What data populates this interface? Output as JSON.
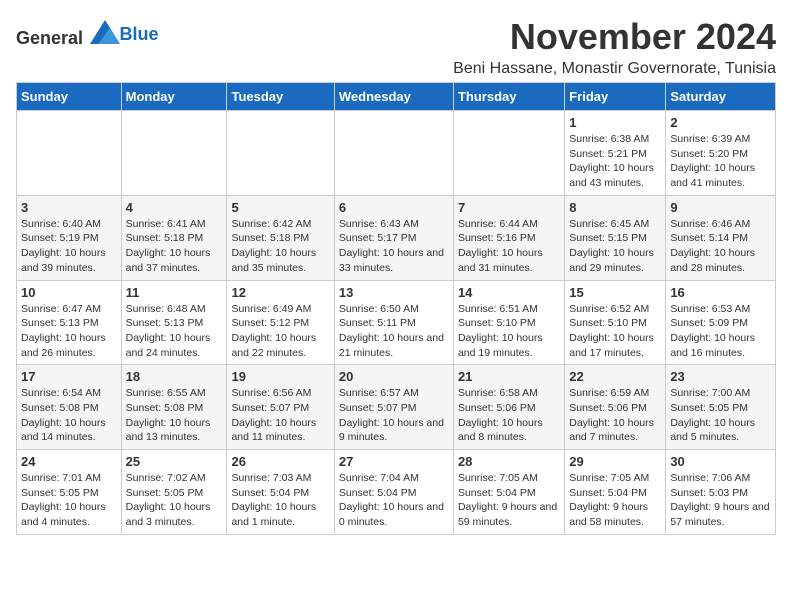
{
  "header": {
    "logo_general": "General",
    "logo_blue": "Blue",
    "month_title": "November 2024",
    "location": "Beni Hassane, Monastir Governorate, Tunisia"
  },
  "weekdays": [
    "Sunday",
    "Monday",
    "Tuesday",
    "Wednesday",
    "Thursday",
    "Friday",
    "Saturday"
  ],
  "weeks": [
    [
      {
        "day": "",
        "info": ""
      },
      {
        "day": "",
        "info": ""
      },
      {
        "day": "",
        "info": ""
      },
      {
        "day": "",
        "info": ""
      },
      {
        "day": "",
        "info": ""
      },
      {
        "day": "1",
        "info": "Sunrise: 6:38 AM\nSunset: 5:21 PM\nDaylight: 10 hours and 43 minutes."
      },
      {
        "day": "2",
        "info": "Sunrise: 6:39 AM\nSunset: 5:20 PM\nDaylight: 10 hours and 41 minutes."
      }
    ],
    [
      {
        "day": "3",
        "info": "Sunrise: 6:40 AM\nSunset: 5:19 PM\nDaylight: 10 hours and 39 minutes."
      },
      {
        "day": "4",
        "info": "Sunrise: 6:41 AM\nSunset: 5:18 PM\nDaylight: 10 hours and 37 minutes."
      },
      {
        "day": "5",
        "info": "Sunrise: 6:42 AM\nSunset: 5:18 PM\nDaylight: 10 hours and 35 minutes."
      },
      {
        "day": "6",
        "info": "Sunrise: 6:43 AM\nSunset: 5:17 PM\nDaylight: 10 hours and 33 minutes."
      },
      {
        "day": "7",
        "info": "Sunrise: 6:44 AM\nSunset: 5:16 PM\nDaylight: 10 hours and 31 minutes."
      },
      {
        "day": "8",
        "info": "Sunrise: 6:45 AM\nSunset: 5:15 PM\nDaylight: 10 hours and 29 minutes."
      },
      {
        "day": "9",
        "info": "Sunrise: 6:46 AM\nSunset: 5:14 PM\nDaylight: 10 hours and 28 minutes."
      }
    ],
    [
      {
        "day": "10",
        "info": "Sunrise: 6:47 AM\nSunset: 5:13 PM\nDaylight: 10 hours and 26 minutes."
      },
      {
        "day": "11",
        "info": "Sunrise: 6:48 AM\nSunset: 5:13 PM\nDaylight: 10 hours and 24 minutes."
      },
      {
        "day": "12",
        "info": "Sunrise: 6:49 AM\nSunset: 5:12 PM\nDaylight: 10 hours and 22 minutes."
      },
      {
        "day": "13",
        "info": "Sunrise: 6:50 AM\nSunset: 5:11 PM\nDaylight: 10 hours and 21 minutes."
      },
      {
        "day": "14",
        "info": "Sunrise: 6:51 AM\nSunset: 5:10 PM\nDaylight: 10 hours and 19 minutes."
      },
      {
        "day": "15",
        "info": "Sunrise: 6:52 AM\nSunset: 5:10 PM\nDaylight: 10 hours and 17 minutes."
      },
      {
        "day": "16",
        "info": "Sunrise: 6:53 AM\nSunset: 5:09 PM\nDaylight: 10 hours and 16 minutes."
      }
    ],
    [
      {
        "day": "17",
        "info": "Sunrise: 6:54 AM\nSunset: 5:08 PM\nDaylight: 10 hours and 14 minutes."
      },
      {
        "day": "18",
        "info": "Sunrise: 6:55 AM\nSunset: 5:08 PM\nDaylight: 10 hours and 13 minutes."
      },
      {
        "day": "19",
        "info": "Sunrise: 6:56 AM\nSunset: 5:07 PM\nDaylight: 10 hours and 11 minutes."
      },
      {
        "day": "20",
        "info": "Sunrise: 6:57 AM\nSunset: 5:07 PM\nDaylight: 10 hours and 9 minutes."
      },
      {
        "day": "21",
        "info": "Sunrise: 6:58 AM\nSunset: 5:06 PM\nDaylight: 10 hours and 8 minutes."
      },
      {
        "day": "22",
        "info": "Sunrise: 6:59 AM\nSunset: 5:06 PM\nDaylight: 10 hours and 7 minutes."
      },
      {
        "day": "23",
        "info": "Sunrise: 7:00 AM\nSunset: 5:05 PM\nDaylight: 10 hours and 5 minutes."
      }
    ],
    [
      {
        "day": "24",
        "info": "Sunrise: 7:01 AM\nSunset: 5:05 PM\nDaylight: 10 hours and 4 minutes."
      },
      {
        "day": "25",
        "info": "Sunrise: 7:02 AM\nSunset: 5:05 PM\nDaylight: 10 hours and 3 minutes."
      },
      {
        "day": "26",
        "info": "Sunrise: 7:03 AM\nSunset: 5:04 PM\nDaylight: 10 hours and 1 minute."
      },
      {
        "day": "27",
        "info": "Sunrise: 7:04 AM\nSunset: 5:04 PM\nDaylight: 10 hours and 0 minutes."
      },
      {
        "day": "28",
        "info": "Sunrise: 7:05 AM\nSunset: 5:04 PM\nDaylight: 9 hours and 59 minutes."
      },
      {
        "day": "29",
        "info": "Sunrise: 7:05 AM\nSunset: 5:04 PM\nDaylight: 9 hours and 58 minutes."
      },
      {
        "day": "30",
        "info": "Sunrise: 7:06 AM\nSunset: 5:03 PM\nDaylight: 9 hours and 57 minutes."
      }
    ]
  ]
}
